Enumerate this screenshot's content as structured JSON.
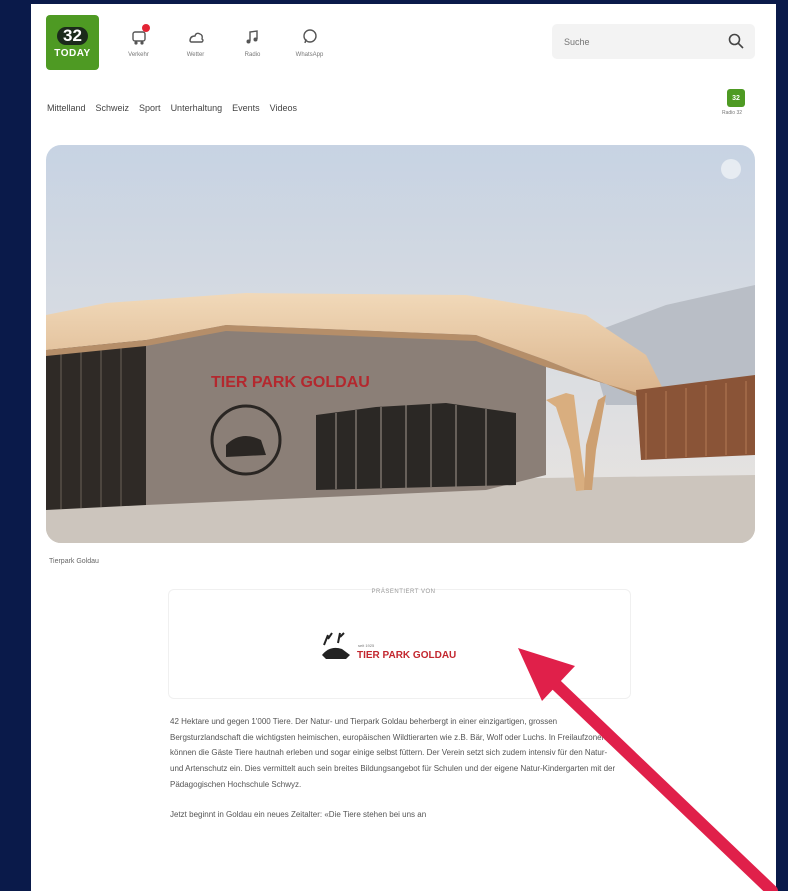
{
  "brand": {
    "number": "32",
    "name": "TODAY"
  },
  "quicklinks": [
    {
      "icon": "traffic-icon",
      "label": "Verkehr"
    },
    {
      "icon": "weather-icon",
      "label": "Wetter"
    },
    {
      "icon": "radio-music-icon",
      "label": "Radio"
    },
    {
      "icon": "whatsapp-icon",
      "label": "WhatsApp"
    }
  ],
  "search": {
    "placeholder": "Suche"
  },
  "nav": [
    "Mittelland",
    "Schweiz",
    "Sport",
    "Unterhaltung",
    "Events",
    "Videos"
  ],
  "radio": {
    "badge": "32",
    "label": "Radio 32"
  },
  "hero": {
    "caption": "Tierpark Goldau",
    "sign_text": "TIER PARK GOLDAU"
  },
  "sponsor": {
    "presented_by": "PRÄSENTIERT VON",
    "logo_small": "seit 1925",
    "logo_text": "TIER PARK GOLDAU"
  },
  "article": {
    "p1": "42 Hektare und gegen 1'000 Tiere. Der Natur- und Tierpark Goldau beherbergt in einer einzigartigen, grossen Bergsturzlandschaft die wichtigsten heimischen, europäischen Wildtierarten wie z.B. Bär, Wolf oder Luchs. In Freilaufzonen können die Gäste Tiere hautnah erleben und sogar einige selbst füttern. Der Verein setzt sich zudem intensiv für den Natur- und Artenschutz ein. Dies vermittelt auch sein breites Bildungsangebot für Schulen und der eigene Natur-Kindergarten mit der Pädagogischen Hochschule Schwyz.",
    "p2": "Jetzt beginnt in Goldau ein neues Zeitalter: «Die Tiere stehen bei uns an"
  },
  "colors": {
    "brand_green": "#4e9a23",
    "accent_red": "#e32434",
    "frame_navy": "#0a1a4a",
    "arrow_red": "#e0204a"
  }
}
